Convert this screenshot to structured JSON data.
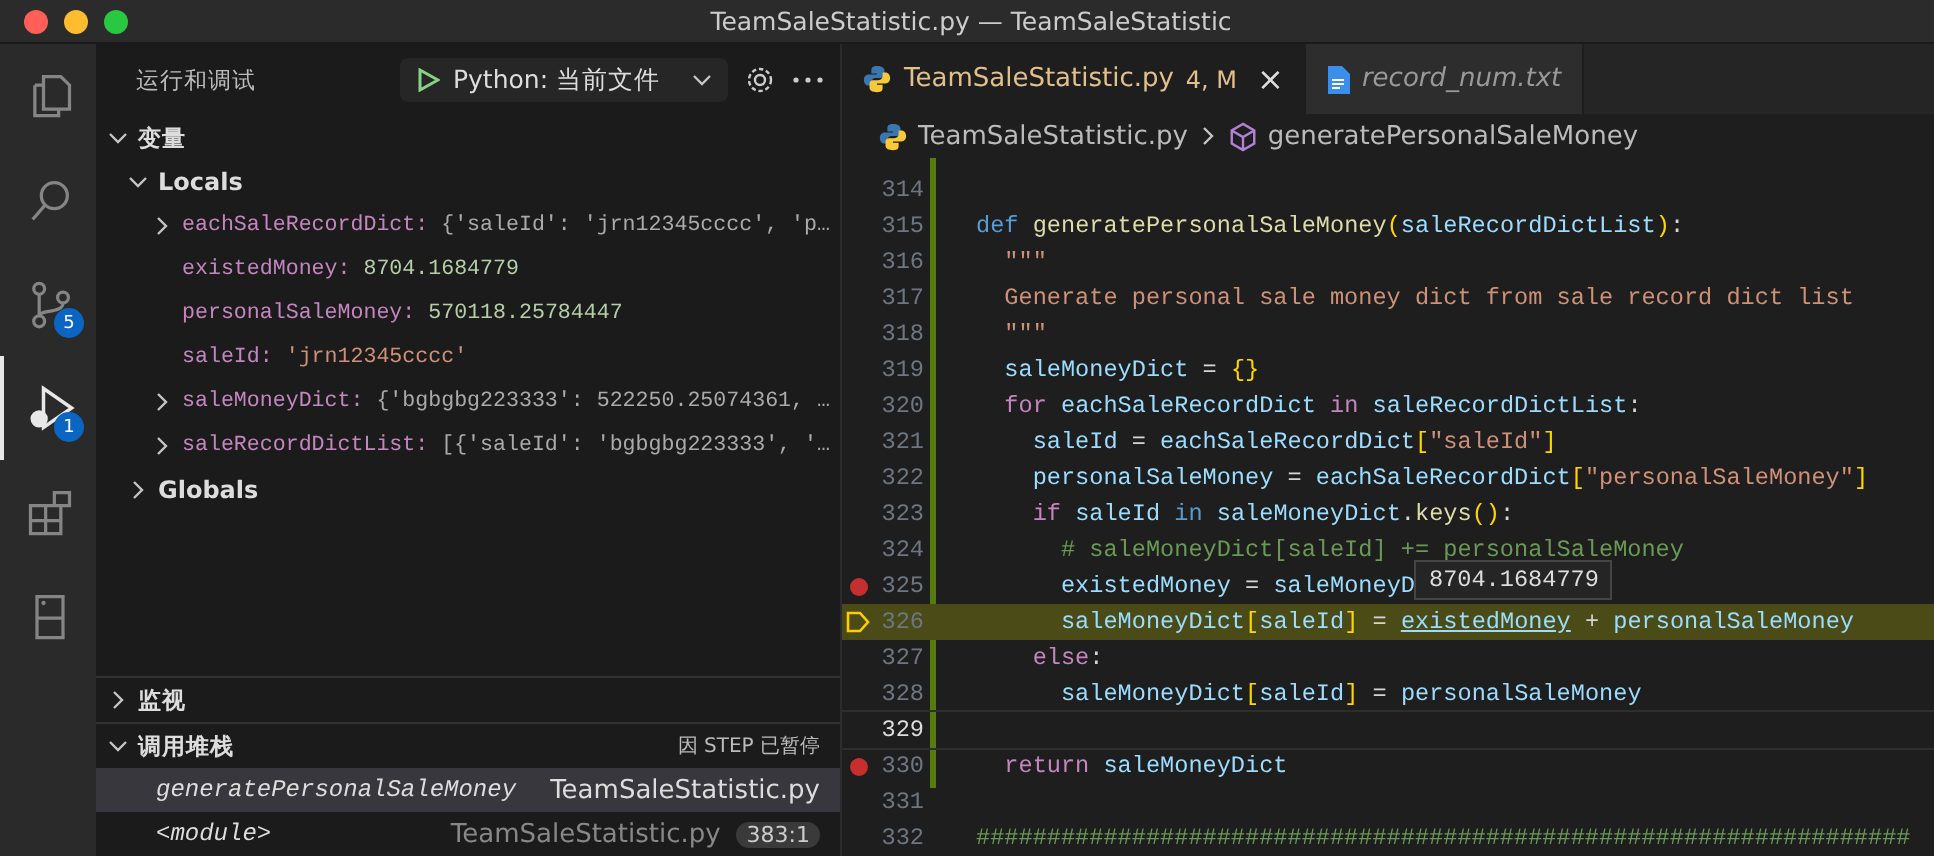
{
  "window": {
    "title": "TeamSaleStatistic.py — TeamSaleStatistic"
  },
  "activity_bar": [
    {
      "kind": "files",
      "selected": false
    },
    {
      "kind": "search",
      "selected": false
    },
    {
      "kind": "scm",
      "selected": false,
      "badge": "5"
    },
    {
      "kind": "debug",
      "selected": true,
      "badge": "1"
    },
    {
      "kind": "extensions",
      "selected": false
    },
    {
      "kind": "remote",
      "selected": false
    }
  ],
  "run_panel": {
    "title": "运行和调试",
    "config": "Python: 当前文件"
  },
  "variables": {
    "title": "变量",
    "expanded": true,
    "scopes": [
      {
        "name": "Locals",
        "expanded": true,
        "children": [
          {
            "name": "eachSaleRecordDict:",
            "value": "{'saleId': 'jrn12345cccc', 'p…",
            "kind": "object",
            "expandable": true
          },
          {
            "name": "existedMoney:",
            "value": "8704.1684779",
            "kind": "number",
            "expandable": false
          },
          {
            "name": "personalSaleMoney:",
            "value": "570118.25784447",
            "kind": "number",
            "expandable": false
          },
          {
            "name": "saleId:",
            "value": "'jrn12345cccc'",
            "kind": "string",
            "expandable": false
          },
          {
            "name": "saleMoneyDict:",
            "value": "{'bgbgbg223333': 522250.25074361, …",
            "kind": "object",
            "expandable": true
          },
          {
            "name": "saleRecordDictList:",
            "value": "[{'saleId': 'bgbgbg223333', '…",
            "kind": "object",
            "expandable": true
          }
        ]
      },
      {
        "name": "Globals",
        "expanded": false
      }
    ]
  },
  "watch": {
    "title": "监视",
    "expanded": false
  },
  "call_stack": {
    "title": "调用堆栈",
    "expanded": true,
    "status": "因 STEP 已暂停",
    "frames": [
      {
        "name": "generatePersonalSaleMoney",
        "file": "TeamSaleStatistic.py",
        "selected": true
      },
      {
        "name": "<module>",
        "file": "TeamSaleStatistic.py",
        "position": "383:1",
        "selected": false
      }
    ]
  },
  "tabs": [
    {
      "label": "TeamSaleStatistic.py",
      "kind": "python",
      "status": "4, M",
      "close": "×",
      "selected": true,
      "preview": false
    },
    {
      "label": "record_num.txt",
      "kind": "text",
      "selected": false,
      "preview": true
    }
  ],
  "breadcrumb": {
    "file": "TeamSaleStatistic.py",
    "symbol": "generatePersonalSaleMoney"
  },
  "code": {
    "lines": [
      {
        "number": "314",
        "breakpoint": false,
        "current": false,
        "cursor": false
      },
      {
        "number": "315",
        "breakpoint": false,
        "current": false,
        "cursor": false,
        "tokens": [
          {
            "kind": "def",
            "s": "def "
          },
          {
            "kind": "fn",
            "s": "generatePersonalSaleMoney"
          },
          {
            "kind": "bracket",
            "s": "("
          },
          {
            "kind": "var",
            "s": "saleRecordDictList"
          },
          {
            "kind": "bracket",
            "s": ")"
          },
          {
            "kind": "punct",
            "s": ":"
          }
        ]
      },
      {
        "number": "316",
        "breakpoint": false,
        "current": false,
        "cursor": false,
        "tokens": [
          {
            "kind": "str",
            "s": "  \"\"\""
          }
        ]
      },
      {
        "number": "317",
        "breakpoint": false,
        "current": false,
        "cursor": false,
        "tokens": [
          {
            "kind": "str",
            "s": "  Generate personal sale money dict from sale record dict list"
          }
        ]
      },
      {
        "number": "318",
        "breakpoint": false,
        "current": false,
        "cursor": false,
        "tokens": [
          {
            "kind": "str",
            "s": "  \"\"\""
          }
        ]
      },
      {
        "number": "319",
        "breakpoint": false,
        "current": false,
        "cursor": false,
        "tokens": [
          {
            "kind": "var",
            "s": "  saleMoneyDict"
          },
          {
            "kind": "punct",
            "s": " = "
          },
          {
            "kind": "bracket",
            "s": "{}"
          }
        ]
      },
      {
        "number": "320",
        "breakpoint": false,
        "current": false,
        "cursor": false,
        "tokens": [
          {
            "kind": "kw",
            "s": "  for "
          },
          {
            "kind": "var",
            "s": "eachSaleRecordDict "
          },
          {
            "kind": "kw",
            "s": "in "
          },
          {
            "kind": "var",
            "s": "saleRecordDictList"
          },
          {
            "kind": "punct",
            "s": ":"
          }
        ]
      },
      {
        "number": "321",
        "breakpoint": false,
        "current": false,
        "cursor": false,
        "tokens": [
          {
            "kind": "var",
            "s": "    saleId"
          },
          {
            "kind": "punct",
            "s": " = "
          },
          {
            "kind": "var",
            "s": "eachSaleRecordDict"
          },
          {
            "kind": "bracket",
            "s": "["
          },
          {
            "kind": "str",
            "s": "\"saleId\""
          },
          {
            "kind": "bracket",
            "s": "]"
          }
        ]
      },
      {
        "number": "322",
        "breakpoint": false,
        "current": false,
        "cursor": false,
        "tokens": [
          {
            "kind": "var",
            "s": "    personalSaleMoney"
          },
          {
            "kind": "punct",
            "s": " = "
          },
          {
            "kind": "var",
            "s": "eachSaleRecordDict"
          },
          {
            "kind": "bracket",
            "s": "["
          },
          {
            "kind": "str",
            "s": "\"personalSaleMoney\""
          },
          {
            "kind": "bracket",
            "s": "]"
          }
        ]
      },
      {
        "number": "323",
        "breakpoint": false,
        "current": false,
        "cursor": false,
        "tokens": [
          {
            "kind": "kw",
            "s": "    if "
          },
          {
            "kind": "var",
            "s": "saleId "
          },
          {
            "kind": "def",
            "s": "in "
          },
          {
            "kind": "var",
            "s": "saleMoneyDict"
          },
          {
            "kind": "punct",
            "s": "."
          },
          {
            "kind": "fn",
            "s": "keys"
          },
          {
            "kind": "bracket",
            "s": "()"
          },
          {
            "kind": "punct",
            "s": ":"
          }
        ]
      },
      {
        "number": "324",
        "breakpoint": false,
        "current": false,
        "cursor": false,
        "tokens": [
          {
            "kind": "com",
            "s": "      # saleMoneyDict[saleId] += personalSaleMoney"
          }
        ]
      },
      {
        "number": "325",
        "breakpoint": true,
        "current": false,
        "cursor": false,
        "tokens": [
          {
            "kind": "var",
            "s": "      existedMoney"
          },
          {
            "kind": "punct",
            "s": " = "
          },
          {
            "kind": "var",
            "s": "saleMoneyD"
          }
        ],
        "hover": "8704.1684779"
      },
      {
        "number": "326",
        "breakpoint": false,
        "current": true,
        "cursor": false,
        "tokens": [
          {
            "kind": "var",
            "s": "      saleMoneyDict"
          },
          {
            "kind": "bracket",
            "s": "["
          },
          {
            "kind": "var",
            "s": "saleId"
          },
          {
            "kind": "bracket",
            "s": "]"
          },
          {
            "kind": "punct",
            "s": " = "
          },
          {
            "kind": "link",
            "s": "existedMoney"
          },
          {
            "kind": "punct",
            "s": " + "
          },
          {
            "kind": "var",
            "s": "personalSaleMoney"
          }
        ]
      },
      {
        "number": "327",
        "breakpoint": false,
        "current": false,
        "cursor": false,
        "tokens": [
          {
            "kind": "kw",
            "s": "    else"
          },
          {
            "kind": "punct",
            "s": ":"
          }
        ]
      },
      {
        "number": "328",
        "breakpoint": false,
        "current": false,
        "cursor": false,
        "tokens": [
          {
            "kind": "var",
            "s": "      saleMoneyDict"
          },
          {
            "kind": "bracket",
            "s": "["
          },
          {
            "kind": "var",
            "s": "saleId"
          },
          {
            "kind": "bracket",
            "s": "]"
          },
          {
            "kind": "punct",
            "s": " = "
          },
          {
            "kind": "var",
            "s": "personalSaleMoney"
          }
        ]
      },
      {
        "number": "329",
        "breakpoint": false,
        "current": false,
        "cursor": true
      },
      {
        "number": "330",
        "breakpoint": true,
        "current": false,
        "cursor": false,
        "tokens": [
          {
            "kind": "kw",
            "s": "  return "
          },
          {
            "kind": "var",
            "s": "saleMoneyDict"
          }
        ]
      },
      {
        "number": "331",
        "breakpoint": false,
        "current": false,
        "cursor": false
      },
      {
        "number": "332",
        "breakpoint": false,
        "current": false,
        "cursor": false,
        "tokens": [
          {
            "kind": "com",
            "s": "##################################################################"
          }
        ]
      }
    ]
  }
}
